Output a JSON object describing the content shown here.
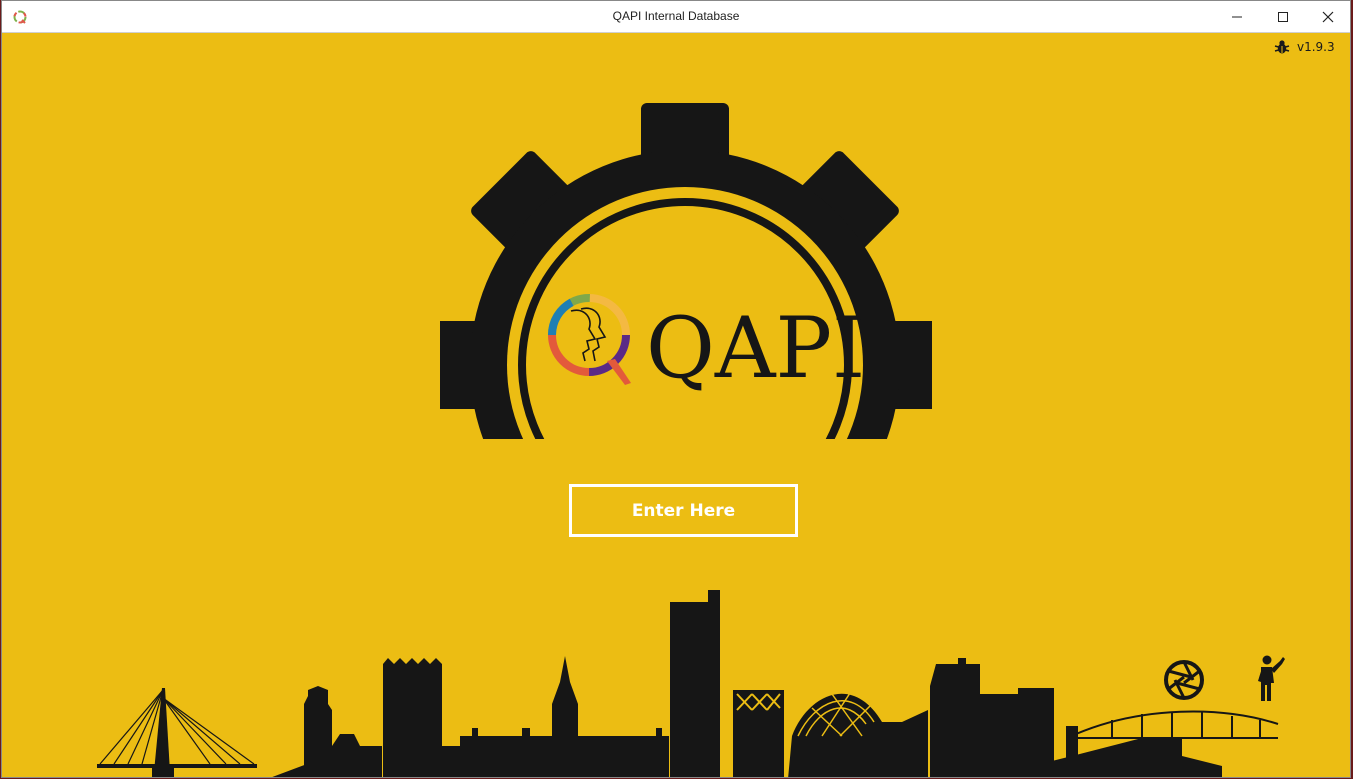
{
  "window": {
    "title": "QAPI Internal Database",
    "app_icon": "qapi-app-icon",
    "controls": [
      "minimize-icon",
      "maximize-icon",
      "close-icon"
    ]
  },
  "header": {
    "version": "v1.9.3",
    "bug_icon": "bug-icon"
  },
  "logo": {
    "text": "QAPI",
    "description_icon": "gear-logo"
  },
  "main": {
    "enter_label": "Enter Here"
  },
  "footer": {
    "icons": [
      "aperture-icon",
      "person-waving-icon"
    ]
  },
  "colors": {
    "background": "#ECBD13",
    "foreground": "#1a1a1a",
    "button_border": "#ffffff"
  }
}
